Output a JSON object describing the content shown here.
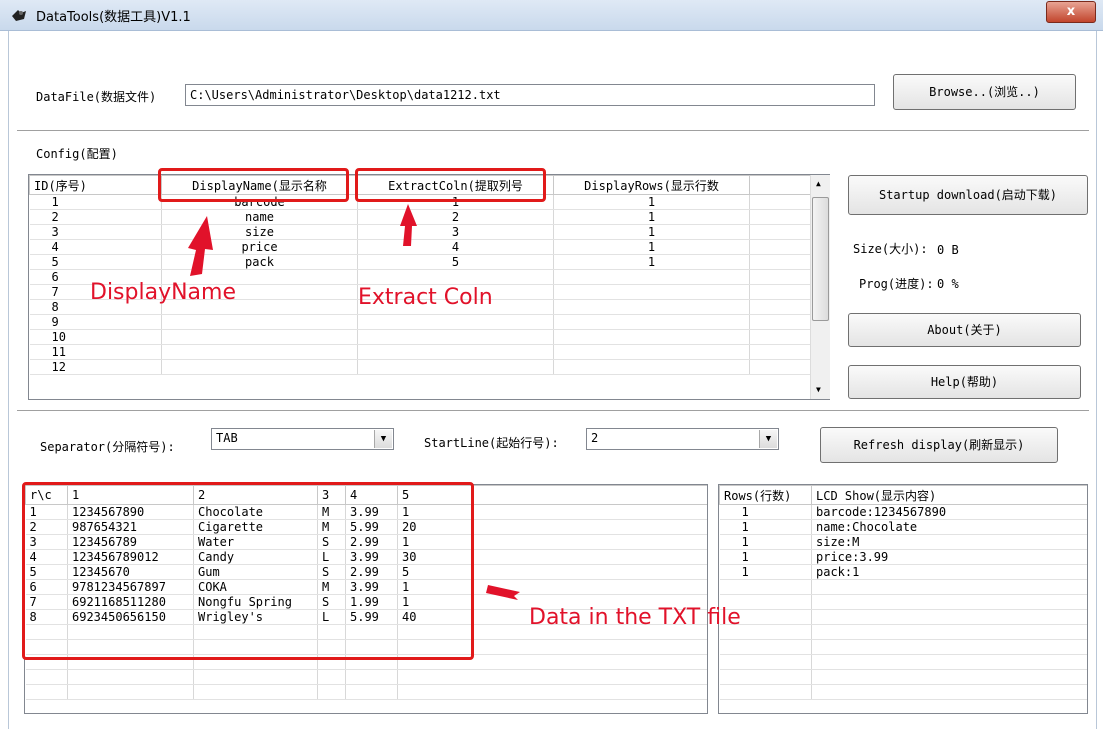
{
  "window": {
    "title": "DataTools(数据工具)V1.1",
    "close_glyph": "x"
  },
  "datafile": {
    "label": "DataFile(数据文件)",
    "path": "C:\\Users\\Administrator\\Desktop\\data1212.txt",
    "browse_label": "Browse..(浏览..)"
  },
  "config": {
    "group_label": "Config(配置)",
    "columns": [
      "ID(序号)",
      "DisplayName(显示名称",
      "ExtractColn(提取列号",
      "DisplayRows(显示行数"
    ],
    "rows": [
      [
        "1",
        "barcode",
        "1",
        "1"
      ],
      [
        "2",
        "name",
        "2",
        "1"
      ],
      [
        "3",
        "size",
        "3",
        "1"
      ],
      [
        "4",
        "price",
        "4",
        "1"
      ],
      [
        "5",
        "pack",
        "5",
        "1"
      ],
      [
        "6",
        "",
        "",
        ""
      ],
      [
        "7",
        "",
        "",
        ""
      ],
      [
        "8",
        "",
        "",
        ""
      ],
      [
        "9",
        "",
        "",
        ""
      ],
      [
        "10",
        "",
        "",
        ""
      ],
      [
        "11",
        "",
        "",
        ""
      ],
      [
        "12",
        "",
        "",
        ""
      ]
    ]
  },
  "side": {
    "startup_label": "Startup download(启动下载)",
    "size_label": "Size(大小):",
    "size_value": "0 B",
    "prog_label": "Prog(进度):",
    "prog_value": "0 %",
    "about_label": "About(关于)",
    "help_label": "Help(帮助)"
  },
  "options": {
    "separator_label": "Separator(分隔符号):",
    "separator_value": "TAB",
    "startline_label": "StartLine(起始行号):",
    "startline_value": "2",
    "refresh_label": "Refresh display(刷新显示)"
  },
  "data_table": {
    "columns": [
      "r\\c",
      "1",
      "2",
      "3",
      "4",
      "5"
    ],
    "rows": [
      [
        "1",
        "1234567890",
        "Chocolate",
        "M",
        "3.99",
        "1"
      ],
      [
        "2",
        "987654321",
        "Cigarette",
        "M",
        "5.99",
        "20"
      ],
      [
        "3",
        "123456789",
        "Water",
        "S",
        "2.99",
        "1"
      ],
      [
        "4",
        "123456789012",
        "Candy",
        "L",
        "3.99",
        "30"
      ],
      [
        "5",
        "12345670",
        "Gum",
        "S",
        "2.99",
        "5"
      ],
      [
        "6",
        "9781234567897",
        "COKA",
        "M",
        "3.99",
        "1"
      ],
      [
        "7",
        "6921168511280",
        "Nongfu Spring",
        "S",
        "1.99",
        "1"
      ],
      [
        "8",
        "6923450656150",
        "Wrigley's",
        "L",
        "5.99",
        "40"
      ],
      [
        "",
        "",
        "",
        "",
        "",
        ""
      ],
      [
        "",
        "",
        "",
        "",
        "",
        ""
      ],
      [
        "",
        "",
        "",
        "",
        "",
        ""
      ],
      [
        "",
        "",
        "",
        "",
        "",
        ""
      ],
      [
        "",
        "",
        "",
        "",
        "",
        ""
      ]
    ]
  },
  "lcd_table": {
    "columns": [
      "Rows(行数)",
      "LCD Show(显示内容)"
    ],
    "rows": [
      [
        "1",
        "barcode:1234567890"
      ],
      [
        "1",
        "name:Chocolate"
      ],
      [
        "1",
        "size:M"
      ],
      [
        "1",
        "price:3.99"
      ],
      [
        "1",
        "pack:1"
      ],
      [
        "",
        ""
      ],
      [
        "",
        ""
      ],
      [
        "",
        ""
      ],
      [
        "",
        ""
      ],
      [
        "",
        ""
      ],
      [
        "",
        ""
      ],
      [
        "",
        ""
      ],
      [
        "",
        ""
      ]
    ]
  },
  "annotations": {
    "display_name": "DisplayName",
    "extract_coln": "Extract Coln",
    "data_in_txt": "Data in the TXT file",
    "color": "#e1122a"
  }
}
